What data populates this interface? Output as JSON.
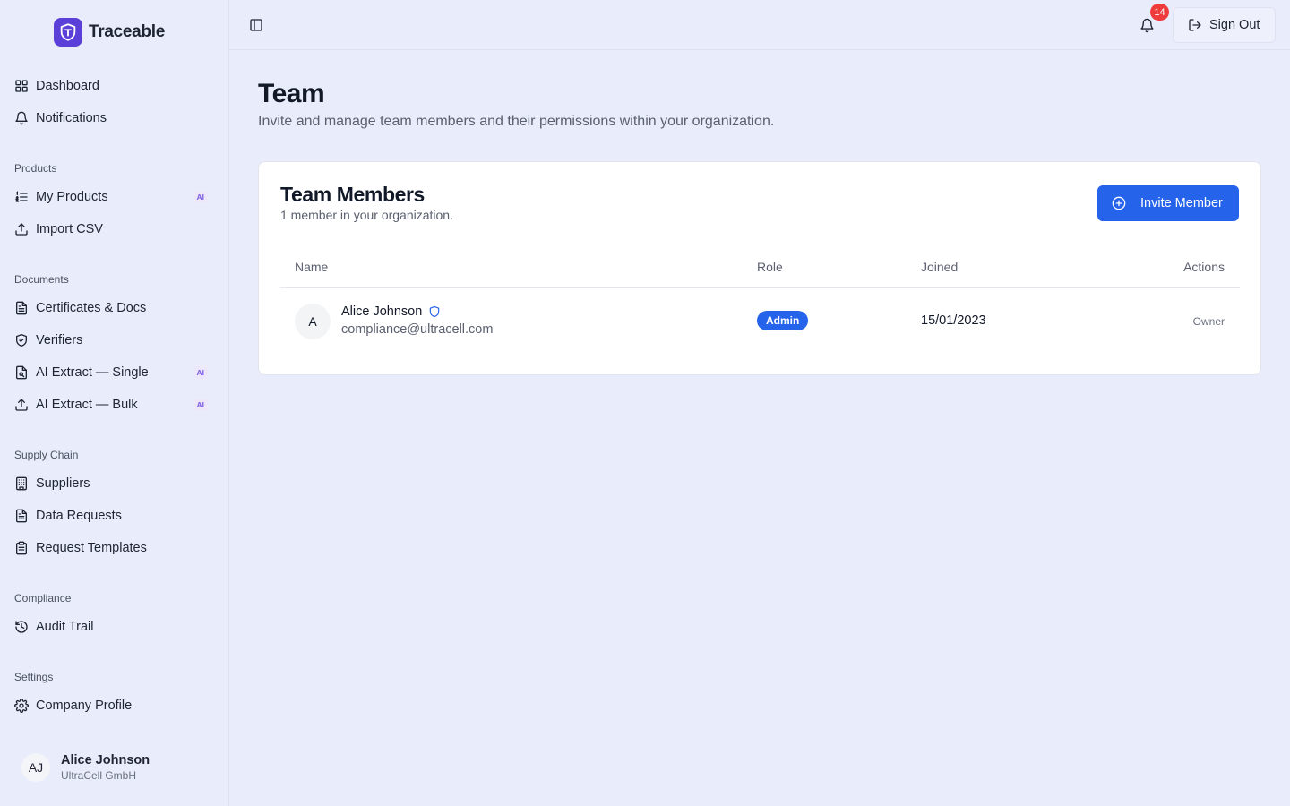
{
  "brand": {
    "name": "Traceable",
    "color": "#5b3fd9"
  },
  "sidebar": {
    "top_items": [
      {
        "label": "Dashboard",
        "icon": "grid-icon"
      },
      {
        "label": "Notifications",
        "icon": "bell-icon"
      }
    ],
    "sections": {
      "products": {
        "label": "Products",
        "items": [
          {
            "label": "My Products",
            "icon": "list-icon",
            "badge": "AI"
          },
          {
            "label": "Import CSV",
            "icon": "upload-icon"
          }
        ]
      },
      "documents": {
        "label": "Documents",
        "items": [
          {
            "label": "Certificates & Docs",
            "icon": "file-icon"
          },
          {
            "label": "Verifiers",
            "icon": "shield-check-icon"
          },
          {
            "label": "AI Extract — Single",
            "icon": "file-scan-icon",
            "badge": "AI"
          },
          {
            "label": "AI Extract — Bulk",
            "icon": "upload-icon",
            "badge": "AI"
          }
        ]
      },
      "supply_chain": {
        "label": "Supply Chain",
        "items": [
          {
            "label": "Suppliers",
            "icon": "building-icon"
          },
          {
            "label": "Data Requests",
            "icon": "file-icon"
          },
          {
            "label": "Request Templates",
            "icon": "clipboard-icon"
          }
        ]
      },
      "compliance": {
        "label": "Compliance",
        "items": [
          {
            "label": "Audit Trail",
            "icon": "history-icon"
          }
        ]
      },
      "settings": {
        "label": "Settings",
        "items": [
          {
            "label": "Company Profile",
            "icon": "gear-icon"
          }
        ]
      }
    },
    "profile": {
      "initials": "AJ",
      "name": "Alice Johnson",
      "org": "UltraCell GmbH"
    }
  },
  "topbar": {
    "notification_count": "14",
    "sign_out_label": "Sign Out"
  },
  "page": {
    "title": "Team",
    "subtitle": "Invite and manage team members and their permissions within your organization."
  },
  "card": {
    "title": "Team Members",
    "subtitle": "1 member in your organization.",
    "invite_label": "Invite Member",
    "columns": {
      "name": "Name",
      "role": "Role",
      "joined": "Joined",
      "actions": "Actions"
    },
    "members": [
      {
        "initial": "A",
        "name": "Alice Johnson",
        "email": "compliance@ultracell.com",
        "role": "Admin",
        "joined": "15/01/2023",
        "action": "Owner"
      }
    ]
  },
  "colors": {
    "primary": "#2563eb",
    "badge_red": "#ef3b3b",
    "ai_badge": "#7c5ce6"
  }
}
